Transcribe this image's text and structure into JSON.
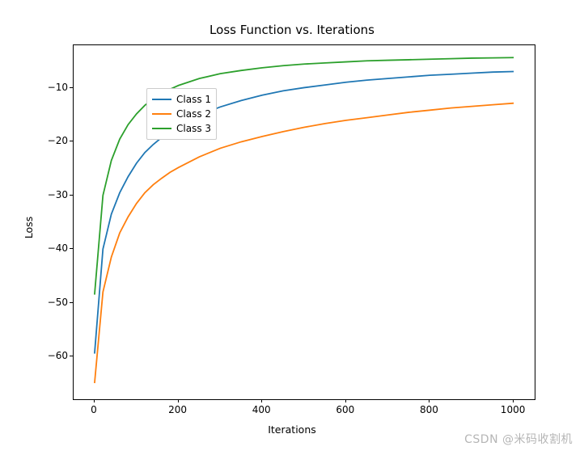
{
  "chart_data": {
    "type": "line",
    "title": "Loss Function vs. Iterations",
    "xlabel": "Iterations",
    "ylabel": "Loss",
    "xlim": [
      -50,
      1050
    ],
    "ylim": [
      -68,
      -2
    ],
    "xticks": [
      0,
      200,
      400,
      600,
      800,
      1000
    ],
    "yticks": [
      -60,
      -50,
      -40,
      -30,
      -20,
      -10
    ],
    "legend_position": "upper left",
    "grid": false,
    "series": [
      {
        "name": "Class 1",
        "color": "#1f77b4",
        "x": [
          0,
          20,
          40,
          60,
          80,
          100,
          120,
          140,
          160,
          180,
          200,
          250,
          300,
          350,
          400,
          450,
          500,
          550,
          600,
          650,
          700,
          750,
          800,
          850,
          900,
          950,
          1000
        ],
        "values": [
          -59.5,
          -40.0,
          -33.5,
          -29.5,
          -26.5,
          -24.0,
          -22.0,
          -20.5,
          -19.2,
          -18.0,
          -17.0,
          -15.0,
          -13.5,
          -12.3,
          -11.3,
          -10.5,
          -9.9,
          -9.4,
          -8.9,
          -8.5,
          -8.2,
          -7.9,
          -7.6,
          -7.4,
          -7.2,
          -7.0,
          -6.9
        ]
      },
      {
        "name": "Class 2",
        "color": "#ff7f0e",
        "x": [
          0,
          20,
          40,
          60,
          80,
          100,
          120,
          140,
          160,
          180,
          200,
          250,
          300,
          350,
          400,
          450,
          500,
          550,
          600,
          650,
          700,
          750,
          800,
          850,
          900,
          950,
          1000
        ],
        "values": [
          -65.0,
          -48.0,
          -41.5,
          -37.0,
          -34.0,
          -31.5,
          -29.5,
          -28.0,
          -26.8,
          -25.7,
          -24.8,
          -22.8,
          -21.2,
          -20.0,
          -19.0,
          -18.1,
          -17.3,
          -16.6,
          -16.0,
          -15.5,
          -15.0,
          -14.5,
          -14.1,
          -13.7,
          -13.4,
          -13.1,
          -12.8
        ]
      },
      {
        "name": "Class 3",
        "color": "#2ca02c",
        "x": [
          0,
          20,
          40,
          60,
          80,
          100,
          120,
          140,
          160,
          180,
          200,
          250,
          300,
          350,
          400,
          450,
          500,
          550,
          600,
          650,
          700,
          750,
          800,
          850,
          900,
          950,
          1000
        ],
        "values": [
          -48.5,
          -30.0,
          -23.5,
          -19.5,
          -16.8,
          -14.8,
          -13.2,
          -12.0,
          -11.0,
          -10.2,
          -9.5,
          -8.2,
          -7.3,
          -6.7,
          -6.2,
          -5.8,
          -5.5,
          -5.3,
          -5.1,
          -4.9,
          -4.8,
          -4.7,
          -4.6,
          -4.5,
          -4.4,
          -4.35,
          -4.3
        ]
      }
    ]
  },
  "watermark": "CSDN @米码收割机"
}
